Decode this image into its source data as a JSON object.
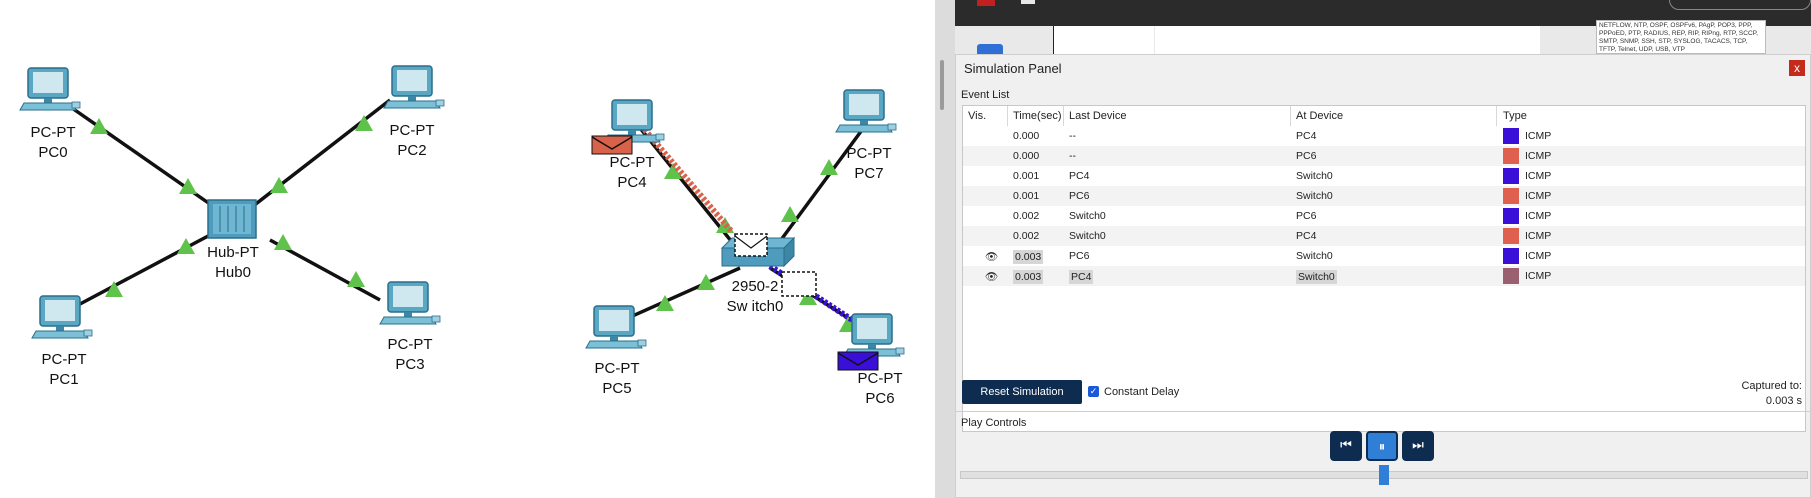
{
  "canvas": {
    "devices": [
      {
        "model": "PC-PT",
        "name": "PC0"
      },
      {
        "model": "PC-PT",
        "name": "PC1"
      },
      {
        "model": "PC-PT",
        "name": "PC2"
      },
      {
        "model": "PC-PT",
        "name": "PC3"
      },
      {
        "model": "Hub-PT",
        "name": "Hub0"
      },
      {
        "model": "PC-PT",
        "name": "PC4"
      },
      {
        "model": "PC-PT",
        "name": "PC5"
      },
      {
        "model": "PC-PT",
        "name": "PC6"
      },
      {
        "model": "PC-PT",
        "name": "PC7"
      },
      {
        "model": "2950-2",
        "name": "Sw itch0"
      }
    ]
  },
  "protocol_filter": {
    "text": "NETFLOW, NTP, OSPF, OSPFv6, PAgP, POP3, PPP, PPPoED, PTP, RADIUS, REP, RIP, RIPng, RTP, SCCP, SMTP, SNMP, SSH, STP, SYSLOG, TACACS, TCP, TFTP, Telnet, UDP, USB, VTP"
  },
  "panel": {
    "title": "Simulation Panel",
    "close": "x",
    "event_list_label": "Event List",
    "columns": [
      "Vis.",
      "Time(sec)",
      "Last Device",
      "At Device",
      "Type"
    ],
    "events": [
      {
        "time": "0.000",
        "last": "--",
        "at": "PC4",
        "type": "ICMP",
        "color": "#3a10d8"
      },
      {
        "time": "0.000",
        "last": "--",
        "at": "PC6",
        "type": "ICMP",
        "color": "#e06050"
      },
      {
        "time": "0.001",
        "last": "PC4",
        "at": "Switch0",
        "type": "ICMP",
        "color": "#3a10d8"
      },
      {
        "time": "0.001",
        "last": "PC6",
        "at": "Switch0",
        "type": "ICMP",
        "color": "#e06050"
      },
      {
        "time": "0.002",
        "last": "Switch0",
        "at": "PC6",
        "type": "ICMP",
        "color": "#3a10d8"
      },
      {
        "time": "0.002",
        "last": "Switch0",
        "at": "PC4",
        "type": "ICMP",
        "color": "#e06050"
      },
      {
        "time": "0.003",
        "last": "PC6",
        "at": "Switch0",
        "type": "ICMP",
        "color": "#3a10d8"
      },
      {
        "time": "0.003",
        "last": "PC4",
        "at": "Switch0",
        "type": "ICMP",
        "color": "#9a6070"
      }
    ],
    "reset_label": "Reset Simulation",
    "constant_delay_label": "Constant Delay",
    "captured_label": "Captured to:",
    "captured_value": "0.003 s",
    "play_controls_label": "Play Controls"
  }
}
